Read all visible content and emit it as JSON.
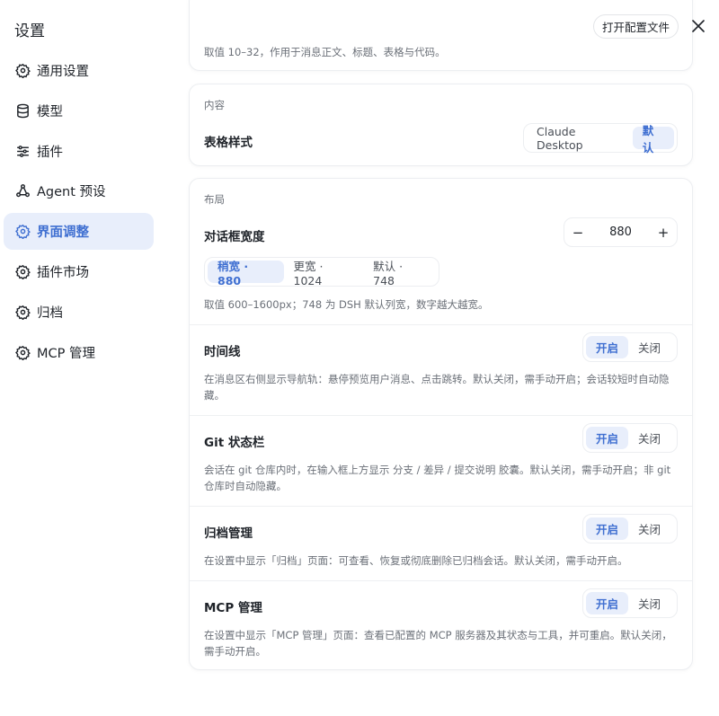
{
  "sidebar": {
    "title": "设置",
    "items": [
      {
        "label": "通用设置",
        "icon": "gear-icon"
      },
      {
        "label": "模型",
        "icon": "database-icon"
      },
      {
        "label": "插件",
        "icon": "sliders-icon"
      },
      {
        "label": "Agent 预设",
        "icon": "agent-icon"
      },
      {
        "label": "界面调整",
        "icon": "gear-icon",
        "active": true
      },
      {
        "label": "插件市场",
        "icon": "gear-icon"
      },
      {
        "label": "归档",
        "icon": "gear-icon"
      },
      {
        "label": "MCP 管理",
        "icon": "gear-icon"
      }
    ]
  },
  "header": {
    "open_config_label": "打开配置文件"
  },
  "top_card": {
    "hint": "取值 10–32，作用于消息正文、标题、表格与代码。"
  },
  "content_card": {
    "section": "内容",
    "table_style_title": "表格样式",
    "options": [
      "Claude Desktop",
      "默认"
    ],
    "selected": "默认"
  },
  "layout_card": {
    "section": "布局",
    "dialog_width": {
      "title": "对话框宽度",
      "minus": "−",
      "plus": "+",
      "value": "880",
      "presets": [
        "稍宽 · 880",
        "更宽 · 1024",
        "默认 · 748"
      ],
      "selected": "稍宽 · 880",
      "hint": "取值 600–1600px；748 为 DSH 默认列宽，数字越大越宽。"
    },
    "toggles": [
      {
        "title": "时间线",
        "on": "开启",
        "off": "关闭",
        "state": "on",
        "hint": "在消息区右侧显示导航轨：悬停预览用户消息、点击跳转。默认关闭，需手动开启；会话较短时自动隐藏。"
      },
      {
        "title": "Git 状态栏",
        "on": "开启",
        "off": "关闭",
        "state": "on",
        "hint": "会话在 git 仓库内时，在输入框上方显示 分支 / 差异 / 提交说明 胶囊。默认关闭，需手动开启；非 git 仓库时自动隐藏。"
      },
      {
        "title": "归档管理",
        "on": "开启",
        "off": "关闭",
        "state": "on",
        "hint": "在设置中显示「归档」页面：可查看、恢复或彻底删除已归档会话。默认关闭，需手动开启。"
      },
      {
        "title": "MCP 管理",
        "on": "开启",
        "off": "关闭",
        "state": "on",
        "hint": "在设置中显示「MCP 管理」页面：查看已配置的 MCP 服务器及其状态与工具，并可重启。默认关闭，需手动开启。"
      }
    ]
  },
  "colors": {
    "accent": "#3f6fd1",
    "accent_bg": "#e8eefb"
  }
}
